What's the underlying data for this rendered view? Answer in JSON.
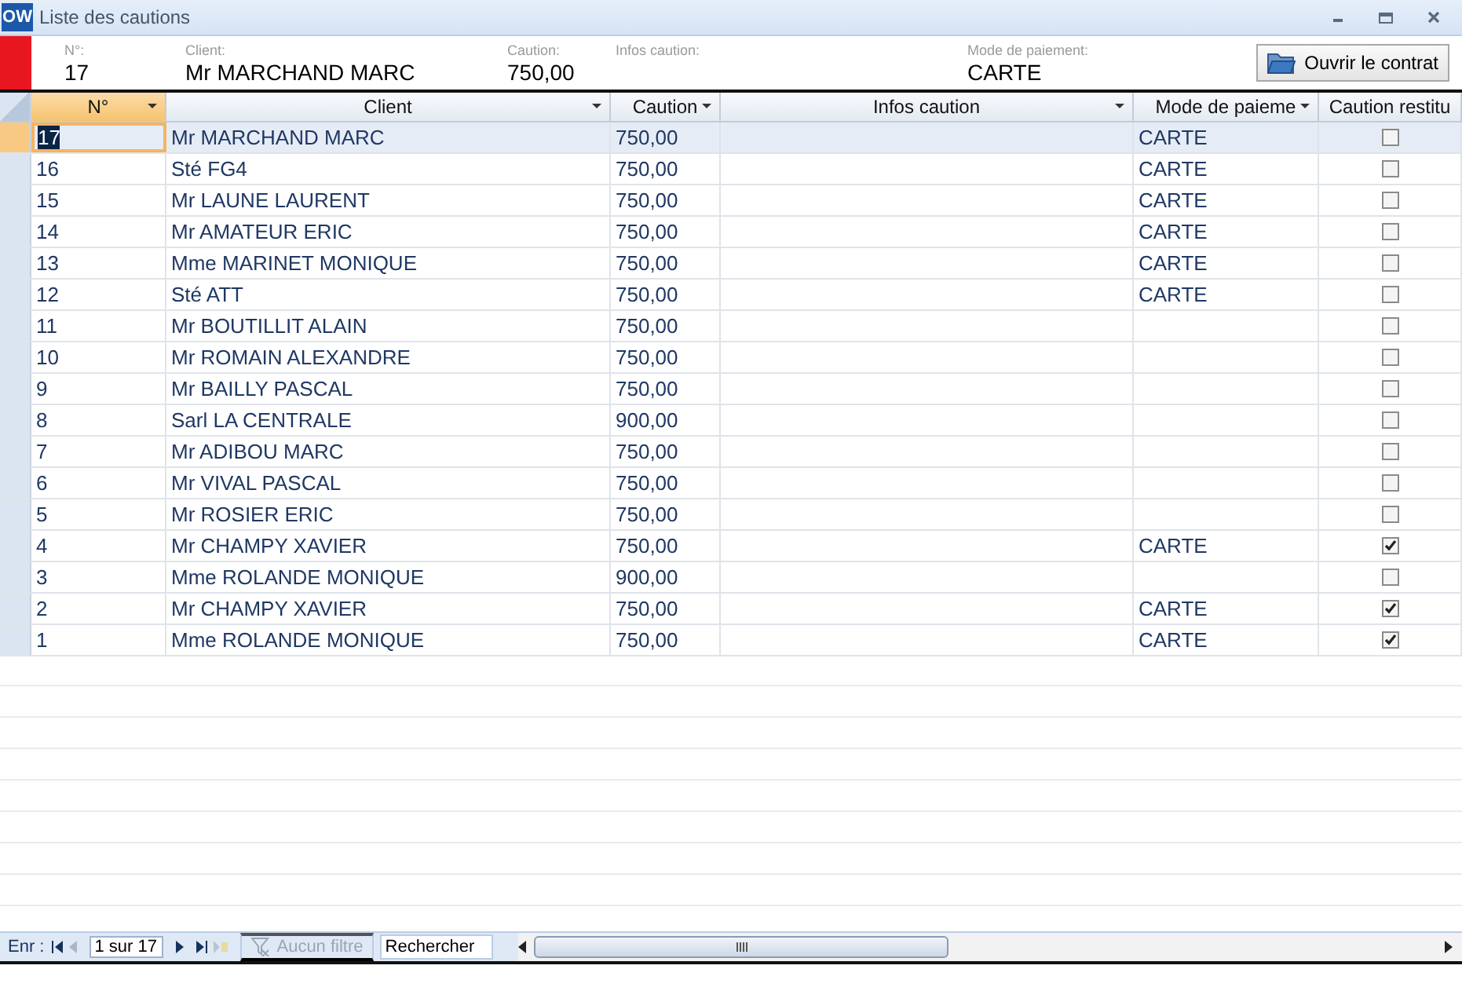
{
  "window": {
    "app_badge": "OW",
    "title": "Liste des cautions"
  },
  "header": {
    "fields": [
      {
        "label": "N°:",
        "value": "17"
      },
      {
        "label": "Client:",
        "value": "Mr MARCHAND MARC"
      },
      {
        "label": "Caution:",
        "value": "750,00"
      },
      {
        "label": "Infos caution:"
      },
      {
        "label": "Mode de paiement:",
        "value": "CARTE"
      }
    ],
    "button": "Ouvrir le contrat"
  },
  "table": {
    "columns": [
      {
        "label": "N°",
        "selected": true
      },
      {
        "label": "Client",
        "selected": false
      },
      {
        "label": "Caution",
        "selected": false
      },
      {
        "label": "Infos caution",
        "selected": false
      },
      {
        "label": "Mode de paieme",
        "selected": false
      },
      {
        "label": "Caution restitu",
        "selected": false
      }
    ],
    "rows": [
      {
        "n": "17",
        "client": "Mr MARCHAND MARC",
        "caution": "750,00",
        "mode": "CARTE",
        "restituted": false,
        "selected": true
      },
      {
        "n": "16",
        "client": "Sté FG4",
        "caution": "750,00",
        "mode": "CARTE",
        "restituted": false,
        "selected": false
      },
      {
        "n": "15",
        "client": "Mr LAUNE LAURENT",
        "caution": "750,00",
        "mode": "CARTE",
        "restituted": false,
        "selected": false
      },
      {
        "n": "14",
        "client": "Mr AMATEUR ERIC",
        "caution": "750,00",
        "mode": "CARTE",
        "restituted": false,
        "selected": false
      },
      {
        "n": "13",
        "client": "Mme MARINET MONIQUE",
        "caution": "750,00",
        "mode": "CARTE",
        "restituted": false,
        "selected": false
      },
      {
        "n": "12",
        "client": "Sté ATT",
        "caution": "750,00",
        "mode": "CARTE",
        "restituted": false,
        "selected": false
      },
      {
        "n": "11",
        "client": "Mr BOUTILLIT ALAIN",
        "caution": "750,00",
        "restituted": false,
        "selected": false
      },
      {
        "n": "10",
        "client": "Mr ROMAIN ALEXANDRE",
        "caution": "750,00",
        "restituted": false,
        "selected": false
      },
      {
        "n": "9",
        "client": "Mr BAILLY PASCAL",
        "caution": "750,00",
        "restituted": false,
        "selected": false
      },
      {
        "n": "8",
        "client": "Sarl LA CENTRALE",
        "caution": "900,00",
        "restituted": false,
        "selected": false
      },
      {
        "n": "7",
        "client": "Mr ADIBOU MARC",
        "caution": "750,00",
        "restituted": false,
        "selected": false
      },
      {
        "n": "6",
        "client": "Mr VIVAL PASCAL",
        "caution": "750,00",
        "restituted": false,
        "selected": false
      },
      {
        "n": "5",
        "client": "Mr ROSIER ERIC",
        "caution": "750,00",
        "restituted": false,
        "selected": false
      },
      {
        "n": "4",
        "client": "Mr CHAMPY XAVIER",
        "caution": "750,00",
        "mode": "CARTE",
        "restituted": true,
        "selected": false
      },
      {
        "n": "3",
        "client": "Mme ROLANDE MONIQUE",
        "caution": "900,00",
        "restituted": false,
        "selected": false
      },
      {
        "n": "2",
        "client": "Mr CHAMPY XAVIER",
        "caution": "750,00",
        "mode": "CARTE",
        "restituted": true,
        "selected": false
      },
      {
        "n": "1",
        "client": "Mme ROLANDE MONIQUE",
        "caution": "750,00",
        "mode": "CARTE",
        "restituted": true,
        "selected": false
      }
    ]
  },
  "navigation": {
    "label": "Enr :",
    "position": "1 sur 17",
    "filter": {
      "label": "Aucun filtre",
      "disabled": true
    },
    "search": {
      "placeholder": "Rechercher"
    }
  }
}
